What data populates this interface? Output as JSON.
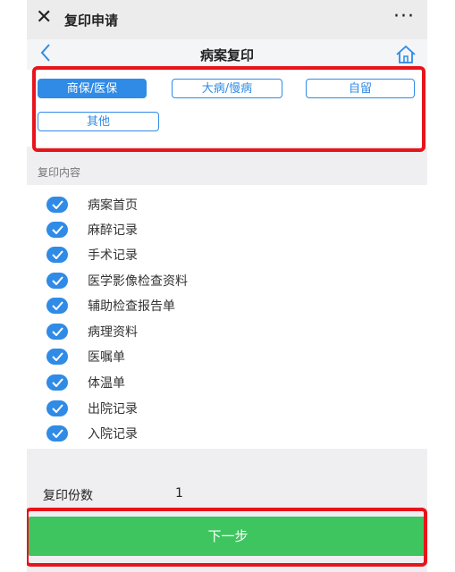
{
  "window": {
    "close_icon": "close-icon",
    "title": "复印申请",
    "more_icon": "more-dots-icon"
  },
  "navbar": {
    "back_icon": "chevron-left-icon",
    "title": "病案复印",
    "home_icon": "home-icon"
  },
  "types": [
    {
      "label": "商保/医保",
      "selected": true
    },
    {
      "label": "大病/慢病",
      "selected": false
    },
    {
      "label": "自留",
      "selected": false
    },
    {
      "label": "其他",
      "selected": false
    }
  ],
  "content": {
    "section_label": "复印内容",
    "items": [
      {
        "label": "病案首页",
        "checked": true
      },
      {
        "label": "麻醉记录",
        "checked": true
      },
      {
        "label": "手术记录",
        "checked": true
      },
      {
        "label": "医学影像检查资料",
        "checked": true
      },
      {
        "label": "辅助检查报告单",
        "checked": true
      },
      {
        "label": "病理资料",
        "checked": true
      },
      {
        "label": "医嘱单",
        "checked": true
      },
      {
        "label": "体温单",
        "checked": true
      },
      {
        "label": "出院记录",
        "checked": true
      },
      {
        "label": "入院记录",
        "checked": true
      }
    ]
  },
  "copies": {
    "label": "复印份数",
    "value": "1"
  },
  "next_button": {
    "label": "下一步"
  },
  "colors": {
    "accent": "#2f8be6",
    "highlight_border": "#e8141b",
    "next_button": "#3ec55f"
  }
}
